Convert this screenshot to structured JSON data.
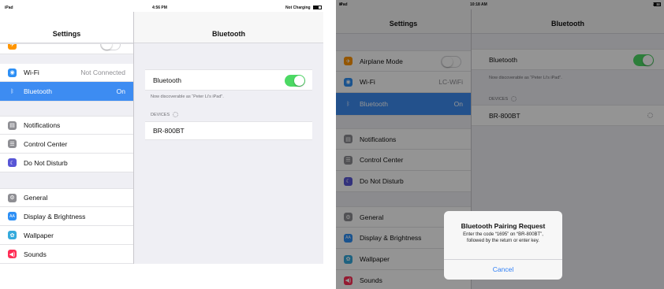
{
  "left": {
    "status": {
      "device": "iPad",
      "time": "4:56 PM",
      "battery": "Not Charging"
    },
    "sidebar_title": "Settings",
    "detail_title": "Bluetooth",
    "sidebar_groups": [
      {
        "items": [
          {
            "label": "Wi-Fi",
            "value": "Not Connected",
            "icon": "wifi-icon",
            "color": "#2d8ff5"
          },
          {
            "label": "Bluetooth",
            "value": "On",
            "icon": "bluetooth-icon",
            "color": "#2d8ff5",
            "selected": true
          }
        ]
      },
      {
        "items": [
          {
            "label": "Notifications",
            "icon": "notifications-icon",
            "color": "#8e8e93"
          },
          {
            "label": "Control Center",
            "icon": "control-center-icon",
            "color": "#8e8e93"
          },
          {
            "label": "Do Not Disturb",
            "icon": "moon-icon",
            "color": "#5856d6"
          }
        ]
      },
      {
        "items": [
          {
            "label": "General",
            "icon": "gear-icon",
            "color": "#8e8e93"
          },
          {
            "label": "Display & Brightness",
            "icon": "brightness-icon",
            "color": "#2d8ff5"
          },
          {
            "label": "Wallpaper",
            "icon": "wallpaper-icon",
            "color": "#35aadc"
          },
          {
            "label": "Sounds",
            "icon": "speaker-icon",
            "color": "#ff2d55"
          }
        ]
      }
    ],
    "bluetooth": {
      "label": "Bluetooth",
      "enabled": true,
      "discoverable_note": "Now discoverable as “Peter Li's iPad”.",
      "devices_header": "DEVICES",
      "devices": [
        "BR-800BT"
      ]
    }
  },
  "right": {
    "status": {
      "device": "iPad",
      "time": "10:18 AM",
      "battery": "24%"
    },
    "sidebar_title": "Settings",
    "detail_title": "Bluetooth",
    "sidebar_groups": [
      {
        "items": [
          {
            "label": "Airplane Mode",
            "icon": "airplane-icon",
            "color": "#ff9500",
            "toggle": false
          },
          {
            "label": "Wi-Fi",
            "value": "LC-WiFi",
            "icon": "wifi-icon",
            "color": "#2d8ff5"
          },
          {
            "label": "Bluetooth",
            "value": "On",
            "icon": "bluetooth-icon",
            "color": "#2d8ff5",
            "selected": true
          }
        ]
      },
      {
        "items": [
          {
            "label": "Notifications",
            "icon": "notifications-icon",
            "color": "#8e8e93"
          },
          {
            "label": "Control Center",
            "icon": "control-center-icon",
            "color": "#8e8e93"
          },
          {
            "label": "Do Not Disturb",
            "icon": "moon-icon",
            "color": "#5856d6"
          }
        ]
      },
      {
        "items": [
          {
            "label": "General",
            "icon": "gear-icon",
            "color": "#8e8e93"
          },
          {
            "label": "Display & Brightness",
            "icon": "brightness-icon",
            "color": "#2d8ff5"
          },
          {
            "label": "Wallpaper",
            "icon": "wallpaper-icon",
            "color": "#35aadc"
          },
          {
            "label": "Sounds",
            "icon": "speaker-icon",
            "color": "#ff2d55"
          }
        ]
      }
    ],
    "bluetooth": {
      "label": "Bluetooth",
      "enabled": true,
      "discoverable_note": "Now discoverable as “Peter Li's iPad”.",
      "devices_header": "DEVICES",
      "devices": [
        "BR-800BT"
      ]
    },
    "alert": {
      "title": "Bluetooth Pairing Request",
      "message_line1": "Enter the code “1695” on “BR-800BT”,",
      "message_line2": "followed by the return or enter key.",
      "cancel_label": "Cancel"
    }
  }
}
